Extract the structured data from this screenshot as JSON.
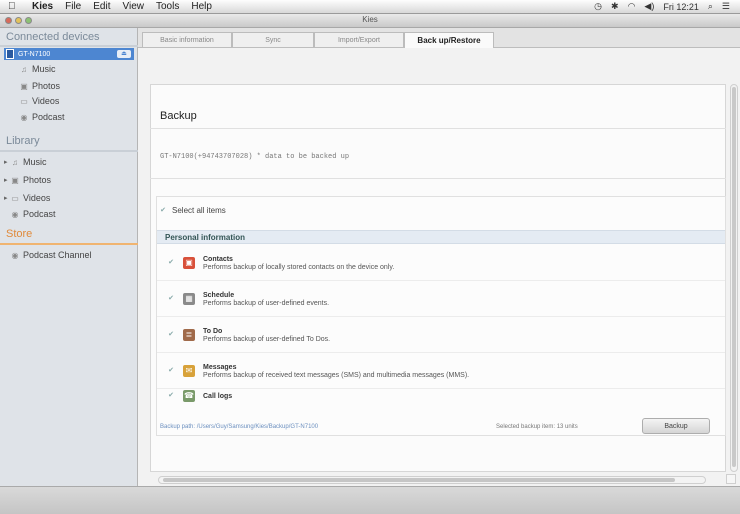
{
  "menubar": {
    "menus": [
      "Kies",
      "File",
      "Edit",
      "View",
      "Tools",
      "Help"
    ],
    "clock": "Fri 12:21"
  },
  "window": {
    "title": "Kies"
  },
  "sidebar": {
    "connected_header": "Connected devices",
    "device": {
      "name": "GT-N7100",
      "button": "⏏"
    },
    "device_items": [
      "Music",
      "Photos",
      "Videos",
      "Podcast"
    ],
    "library_header": "Library",
    "library_items": [
      "Music",
      "Photos",
      "Videos",
      "Podcast"
    ],
    "store_header": "Store",
    "store_items": [
      "Podcast Channel"
    ]
  },
  "tabs": [
    "Basic information",
    "Sync",
    "Import/Export",
    "Back up/Restore"
  ],
  "active_tab": "Back up/Restore",
  "backup": {
    "title": "Backup",
    "device_line": "GT-N7100(+94743707028)  * data to be backed up",
    "select_all": "Select all items",
    "group": "Personal information",
    "items": [
      {
        "name": "Contacts",
        "desc": "Performs backup of locally stored contacts on the device only.",
        "icon": "contacts-icon",
        "color": "#d8503a"
      },
      {
        "name": "Schedule",
        "desc": "Performs backup of user-defined events.",
        "icon": "calendar-icon",
        "color": "#8a8a8a"
      },
      {
        "name": "To Do",
        "desc": "Performs backup of user-defined To Dos.",
        "icon": "todo-icon",
        "color": "#a06a4a"
      },
      {
        "name": "Messages",
        "desc": "Performs backup of received text messages (SMS) and multimedia messages (MMS).",
        "icon": "message-icon",
        "color": "#d8a23a"
      },
      {
        "name": "Call logs",
        "desc": "",
        "icon": "phone-icon",
        "color": "#7a9a6a"
      }
    ],
    "path": "Backup path: /Users/Guy/Samsung/Kies/Backup/GT-N7100",
    "selected_info": "Selected backup item:   13 units",
    "button": "Backup"
  }
}
